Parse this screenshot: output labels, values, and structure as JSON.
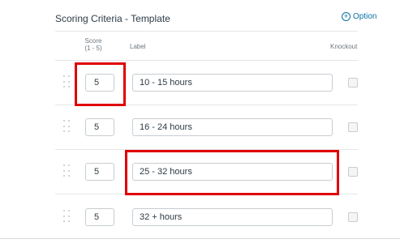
{
  "header": {
    "title": "Scoring Criteria - Template",
    "option_label": "Option"
  },
  "columns": {
    "score": "Score",
    "score_range": "(1 - 5)",
    "label": "Label",
    "knockout": "Knockout"
  },
  "rows": [
    {
      "score": "5",
      "label": "10 - 15 hours",
      "knockout": false
    },
    {
      "score": "5",
      "label": "16 - 24 hours",
      "knockout": false
    },
    {
      "score": "5",
      "label": "25 - 32 hours",
      "knockout": false
    },
    {
      "score": "5",
      "label": "32 + hours",
      "knockout": false
    }
  ],
  "colors": {
    "highlight": "#e00000",
    "link": "#0770a3",
    "text": "#2d3b45"
  }
}
